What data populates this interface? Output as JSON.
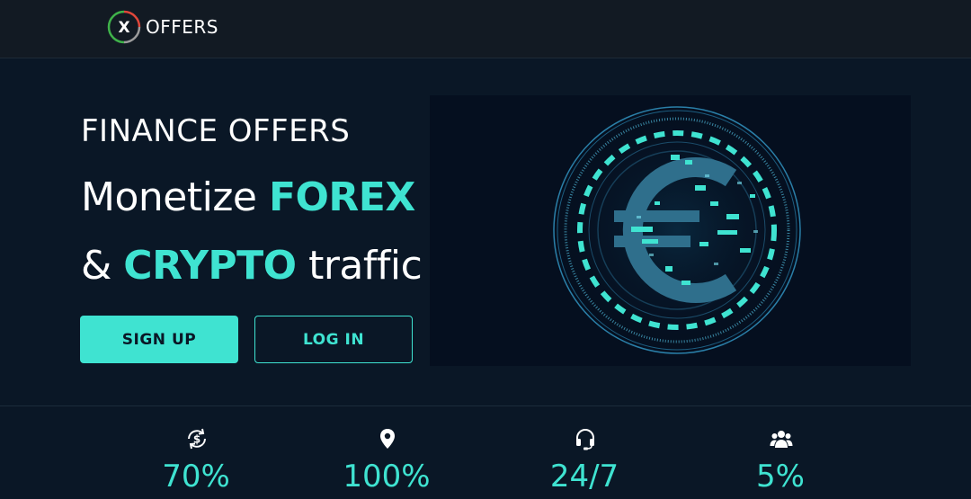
{
  "brand": {
    "logo_letter": "X",
    "name": "OFFERS"
  },
  "hero": {
    "eyebrow": "FINANCE OFFERS",
    "line1_prefix": "Monetize ",
    "line1_accent": "FOREX",
    "line2_prefix": "& ",
    "line2_accent": "CRYPTO",
    "line2_suffix": " traffic"
  },
  "buttons": {
    "signup": "SIGN UP",
    "login": "LOG IN"
  },
  "coin": {
    "symbol": "€"
  },
  "stats": [
    {
      "icon": "dollar-cycle-icon",
      "value": "70%"
    },
    {
      "icon": "location-pin-icon",
      "value": "100%"
    },
    {
      "icon": "headset-icon",
      "value": "24/7"
    },
    {
      "icon": "users-group-icon",
      "value": "5%"
    }
  ],
  "colors": {
    "accent": "#3fe3d1",
    "background": "#0a1726",
    "header": "#121a23"
  }
}
